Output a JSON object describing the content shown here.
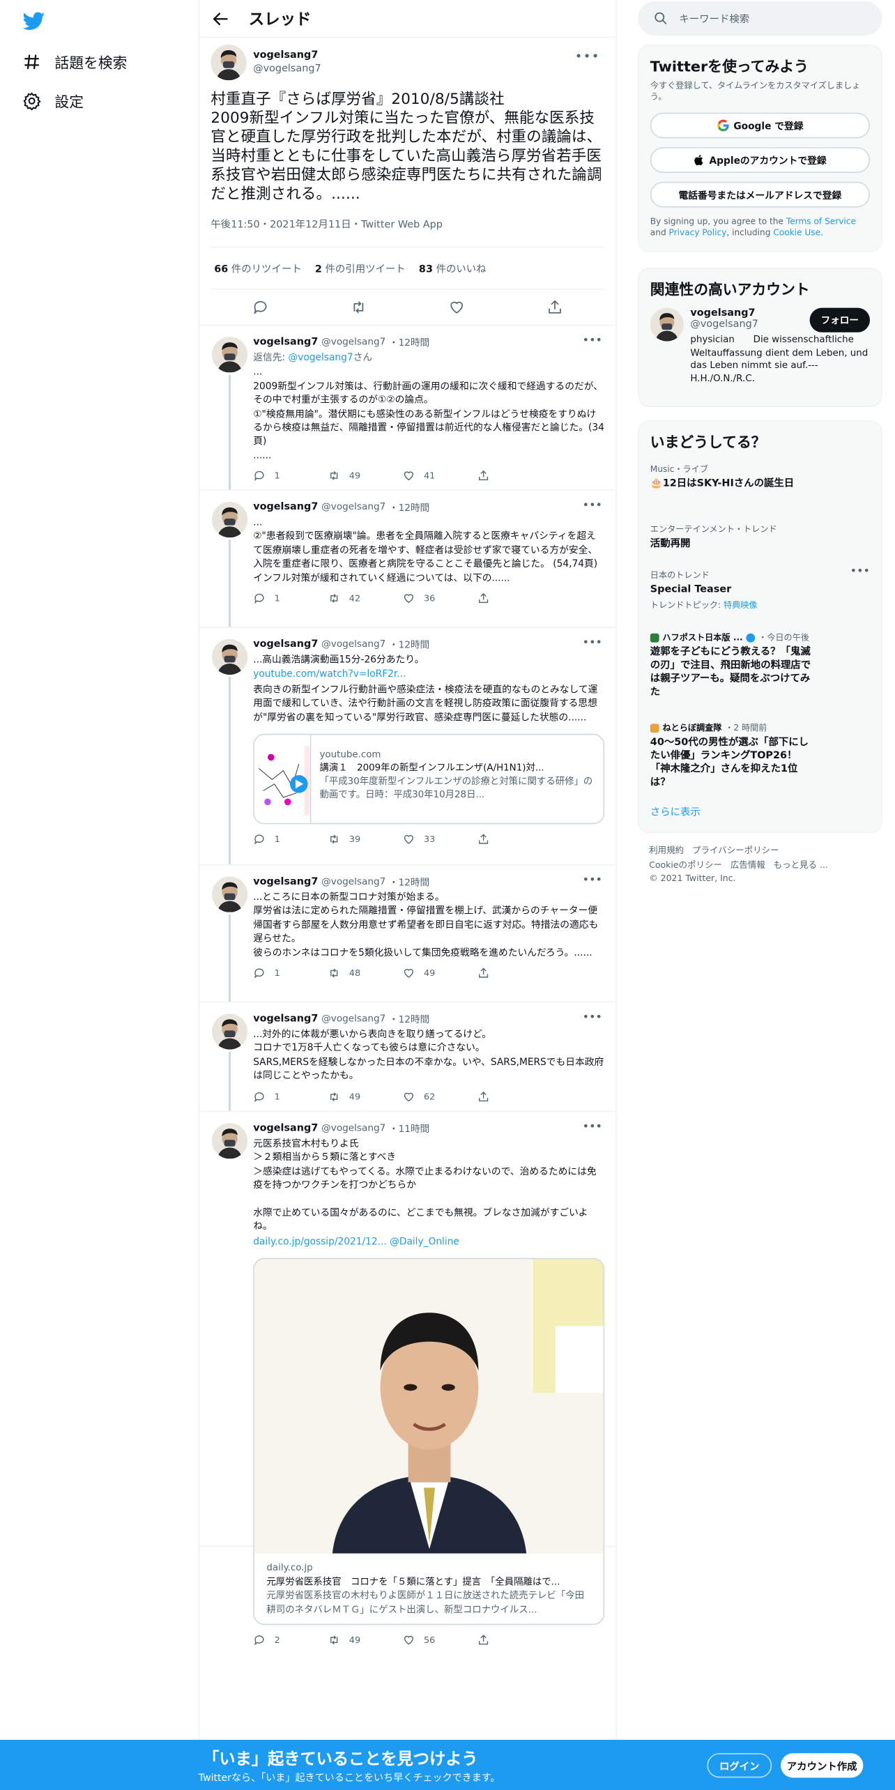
{
  "nav": {
    "explore": "話題を検索",
    "settings": "設定"
  },
  "header": {
    "title": "スレッド"
  },
  "main_tweet": {
    "name": "vogelsang7",
    "handle": "@vogelsang7",
    "text": "村重直子『さらば厚労省』2010/8/5講談社\n2009新型インフル対策に当たった官僚が、無能な医系技官と硬直した厚労行政を批判した本だが、村重の議論は、当時村重とともに仕事をしていた高山義浩ら厚労省若手医系技官や岩田健太郎ら感染症専門医たちに共有された論調だと推測される。......",
    "meta": "午後11:50・2021年12月11日・Twitter Web App",
    "retweets": "66",
    "retweets_label": "件のリツイート",
    "quotes": "2",
    "quotes_label": "件の引用ツイート",
    "likes": "83",
    "likes_label": "件のいいね"
  },
  "replies": [
    {
      "name": "vogelsang7",
      "handle": "@vogelsang7",
      "time": "・12時間",
      "reply_prefix": "返信先: ",
      "reply_to": "@vogelsang7",
      "reply_suffix": "さん",
      "text": "...\n2009新型インフル対策は、行動計画の運用の緩和に次ぐ緩和で経過するのだが、その中で村重が主張するのが①②の論点。\n①\"検疫無用論\"。潜伏期にも感染性のある新型インフルはどうせ検疫をすりぬけるから検疫は無益だ、隔離措置・停留措置は前近代的な人権侵害だと論じた。(34頁)\n......",
      "replies": "1",
      "retweets": "49",
      "likes": "41"
    },
    {
      "name": "vogelsang7",
      "handle": "@vogelsang7",
      "time": "・12時間",
      "text": "...\n②\"患者殺到で医療崩壊\"論。患者を全員隔離入院すると医療キャパシティを超えて医療崩壊し重症者の死者を増やす、軽症者は受診せず家で寝ている方が安全、入院を重症者に限り、医療者と病院を守ることこそ最優先と論じた。 (54,74頁)\nインフル対策が緩和されていく経過については、以下の......",
      "replies": "1",
      "retweets": "42",
      "likes": "36"
    },
    {
      "name": "vogelsang7",
      "handle": "@vogelsang7",
      "time": "・12時間",
      "text_a": "...高山義浩講演動画15分-26分あたり。",
      "link": "youtube.com/watch?v=loRF2r...",
      "text_b": "表向きの新型インフル行動計画や感染症法・検疫法を硬直的なものとみなして運用面で緩和していき、法や行動計画の文言を軽視し防疫政策に面従腹背する思想が\"厚労省の裏を知っている\"厚労行政官、感染症専門医に蔓延した状態の......",
      "card": {
        "domain": "youtube.com",
        "title": "講演１　2009年の新型インフルエンザ(A/H1N1)対...",
        "desc": "「平成30年度新型インフルエンザの診療と対策に関する研修」の動画です。日時：平成30年10月28日..."
      },
      "replies": "1",
      "retweets": "39",
      "likes": "33"
    },
    {
      "name": "vogelsang7",
      "handle": "@vogelsang7",
      "time": "・12時間",
      "text": "...ところに日本の新型コロナ対策が始まる。\n厚労省は法に定められた隔離措置・停留措置を棚上げ、武漢からのチャーター便帰国者すら部屋を人数分用意せず希望者を即日自宅に返す対応。特措法の適応も遅らせた。\n彼らのホンネはコロナを5類化扱いして集団免疫戦略を進めたいんだろう。......",
      "replies": "1",
      "retweets": "48",
      "likes": "49"
    },
    {
      "name": "vogelsang7",
      "handle": "@vogelsang7",
      "time": "・12時間",
      "text": "...対外的に体裁が悪いから表向きを取り繕ってるけど。\nコロナで1万8千人亡くなっても彼らは意に介さない。\nSARS,MERSを経験しなかった日本の不幸かな。いや、SARS,MERSでも日本政府は同じことやったかも。",
      "replies": "1",
      "retweets": "49",
      "likes": "62"
    },
    {
      "name": "vogelsang7",
      "handle": "@vogelsang7",
      "time": "・11時間",
      "text": "元医系技官木村もりよ氏\n＞２類相当から５類に落とすべき\n＞感染症は逃げてもやってくる。水際で止まるわけないので、治めるためには免疫を持つかワクチンを打つかどちらか\n\n水際で止めている国々があるのに、どこまでも無視。ブレなさ加減がすごいよね。",
      "link": "daily.co.jp/gossip/2021/12...",
      "mention": "@Daily_Online",
      "card": {
        "domain": "daily.co.jp",
        "title": "元厚労省医系技官　コロナを「５類に落とす」提言　「全員隔離はで...",
        "desc": "元厚労省医系技官の木村もりよ医師が１１日に放送された読売テレビ「今田耕司のネタバレＭＴＧ」にゲスト出演し、新型コロナウイルス..."
      },
      "replies": "2",
      "retweets": "49",
      "likes": "56"
    }
  ],
  "sidebar": {
    "search_placeholder": "キーワード検索",
    "signup": {
      "title": "Twitterを使ってみよう",
      "sub": "今すぐ登録して、タイムラインをカスタマイズしましょう。",
      "google": "Google で登録",
      "apple": "Appleのアカウントで登録",
      "phone": "電話番号またはメールアドレスで登録",
      "terms_a": "By signing up, you agree to the ",
      "terms_tos": "Terms of Service",
      "terms_b": " and ",
      "terms_pp": "Privacy Policy",
      "terms_c": ", including ",
      "terms_cu": "Cookie Use",
      "terms_d": "."
    },
    "related": {
      "title": "関連性の高いアカウント",
      "name": "vogelsang7",
      "handle": "@vogelsang7",
      "follow": "フォロー",
      "bio": "physician　　Die wissenschaftliche Weltauffassung dient dem Leben, und das Leben nimmt sie auf.---H.H./O.N./R.C."
    },
    "trends": {
      "title": "いまどうしてる？",
      "items": [
        {
          "cat": "Music・ライブ",
          "title": "🎂12日はSKY-HIさんの誕生日"
        },
        {
          "cat": "エンターテインメント・トレンド",
          "title": "活動再開"
        },
        {
          "cat": "日本のトレンド",
          "title": "Special Teaser",
          "meta_label": "トレンドトピック: ",
          "meta_link": "特典映像"
        },
        {
          "source": "ハフポスト日本版 ...",
          "when": "・今日の午後",
          "title": "遊郭を子どもにどう教える？「鬼滅の刃」で注目、飛田新地の料理店では親子ツアーも。疑問をぶつけてみた"
        },
        {
          "source": "ねとらぼ調査隊",
          "when": "・2 時間前",
          "title": "40～50代の男性が選ぶ「部下にしたい俳優」ランキングTOP26！「神木隆之介」さんを抑えた1位は？"
        }
      ],
      "more": "さらに表示"
    },
    "footer": {
      "l1": "利用規約",
      "l2": "プライバシーポリシー",
      "l3": "Cookieのポリシー",
      "l4": "広告情報",
      "l5": "もっと見る ...",
      "copy": "© 2021 Twitter, Inc."
    }
  },
  "bottom": {
    "title": "「いま」起きていることを見つけよう",
    "sub": "Twitterなら、「いま」起きていることをいち早くチェックできます。",
    "login": "ログイン",
    "signup": "アカウント作成"
  },
  "colors": {
    "accent": "#1d9bf0",
    "text": "#0f1419",
    "muted": "#536471"
  }
}
